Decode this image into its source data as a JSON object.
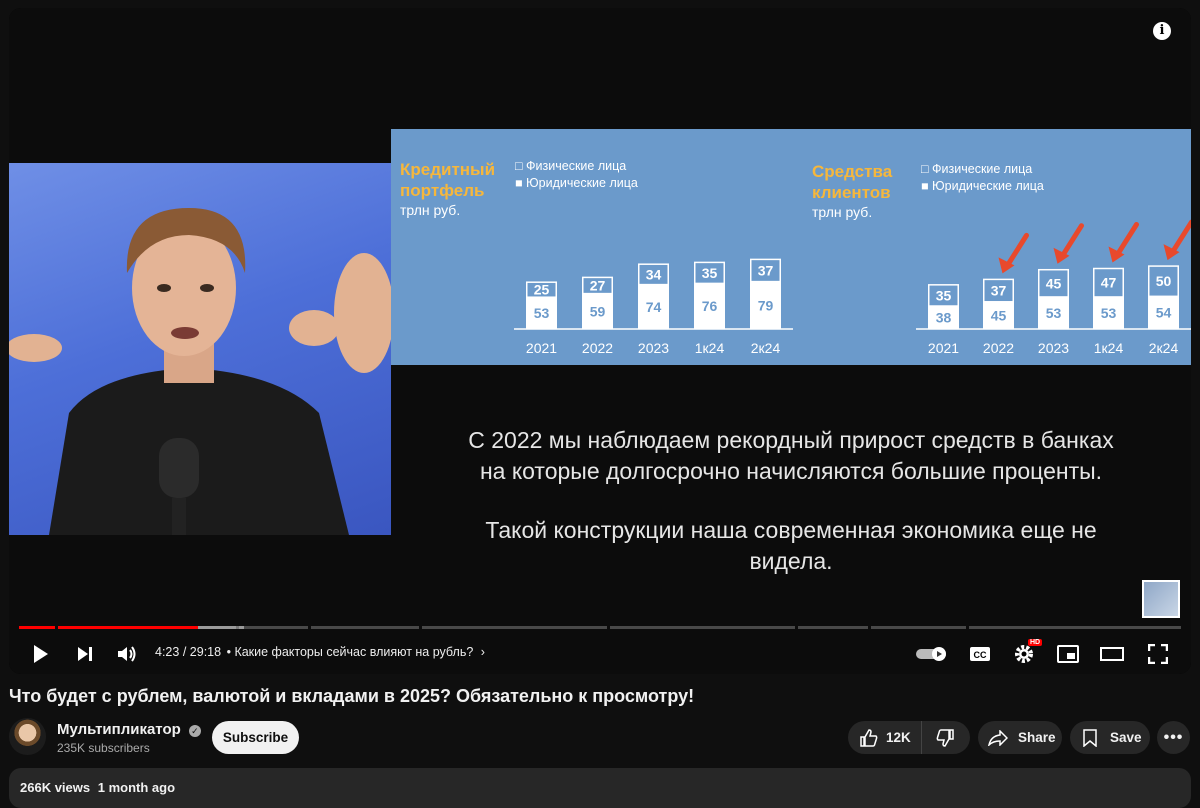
{
  "slide": {
    "left_chart": {
      "title_line1": "Кредитный",
      "title_line2": "портфель",
      "unit": "трлн руб.",
      "legend_individuals": "Физические лица",
      "legend_legal": "Юридические лица"
    },
    "right_chart": {
      "title_line1": "Средства",
      "title_line2": "клиентов",
      "unit": "трлн руб.",
      "legend_individuals": "Физические лица",
      "legend_legal": "Юридические лица"
    },
    "caption_line1": "С 2022 мы наблюдаем рекордный прирост средств в банках",
    "caption_line2": "на которые долгосрочно начисляются большие проценты.",
    "caption_line3": "Такой конструкции наша современная экономика еще не",
    "caption_line4": "видела."
  },
  "chart_data": [
    {
      "type": "bar",
      "title": "Кредитный портфель",
      "ylabel": "трлн руб.",
      "categories": [
        "2021",
        "2022",
        "2023",
        "1к24",
        "2к24"
      ],
      "series": [
        {
          "name": "Физические лица",
          "values": [
            25,
            27,
            34,
            35,
            37
          ]
        },
        {
          "name": "Юридические лица",
          "values": [
            53,
            59,
            74,
            76,
            79
          ]
        }
      ],
      "stacked": true
    },
    {
      "type": "bar",
      "title": "Средства клиентов",
      "ylabel": "трлн руб.",
      "categories": [
        "2021",
        "2022",
        "2023",
        "1к24",
        "2к24"
      ],
      "series": [
        {
          "name": "Физические лица",
          "values": [
            35,
            37,
            45,
            47,
            50
          ]
        },
        {
          "name": "Юридические лица",
          "values": [
            38,
            45,
            53,
            53,
            54
          ]
        }
      ],
      "stacked": true,
      "annotations": "red arrows pointing at 2022, 2023, 1к24, 2к24 bars"
    }
  ],
  "player": {
    "time_current": "4:23",
    "time_total": "29:18",
    "time_separator": "/",
    "chapter_title": "Какие факторы сейчас влияют на рубль?",
    "hd_badge": "HD",
    "progress_fraction": 0.15,
    "icons": [
      "play-icon",
      "next-icon",
      "volume-icon",
      "autoplay-toggle-icon",
      "captions-icon",
      "settings-icon",
      "miniplayer-icon",
      "theater-icon",
      "fullscreen-icon",
      "info-icon"
    ]
  },
  "video": {
    "title": "Что будет с рублем, валютой и вкладами в 2025? Обязательно к просмотру!",
    "channel_name": "Мультипликатор",
    "subscribers": "235K subscribers",
    "subscribe_label": "Subscribe",
    "likes": "12K",
    "share_label": "Share",
    "save_label": "Save",
    "views": "266K views",
    "uploaded": "1 month ago"
  },
  "colors": {
    "slide_bg": "#6b9acb",
    "title_accent": "#f6b73c",
    "progress": "#ff0000",
    "arrow": "#e8492c"
  }
}
